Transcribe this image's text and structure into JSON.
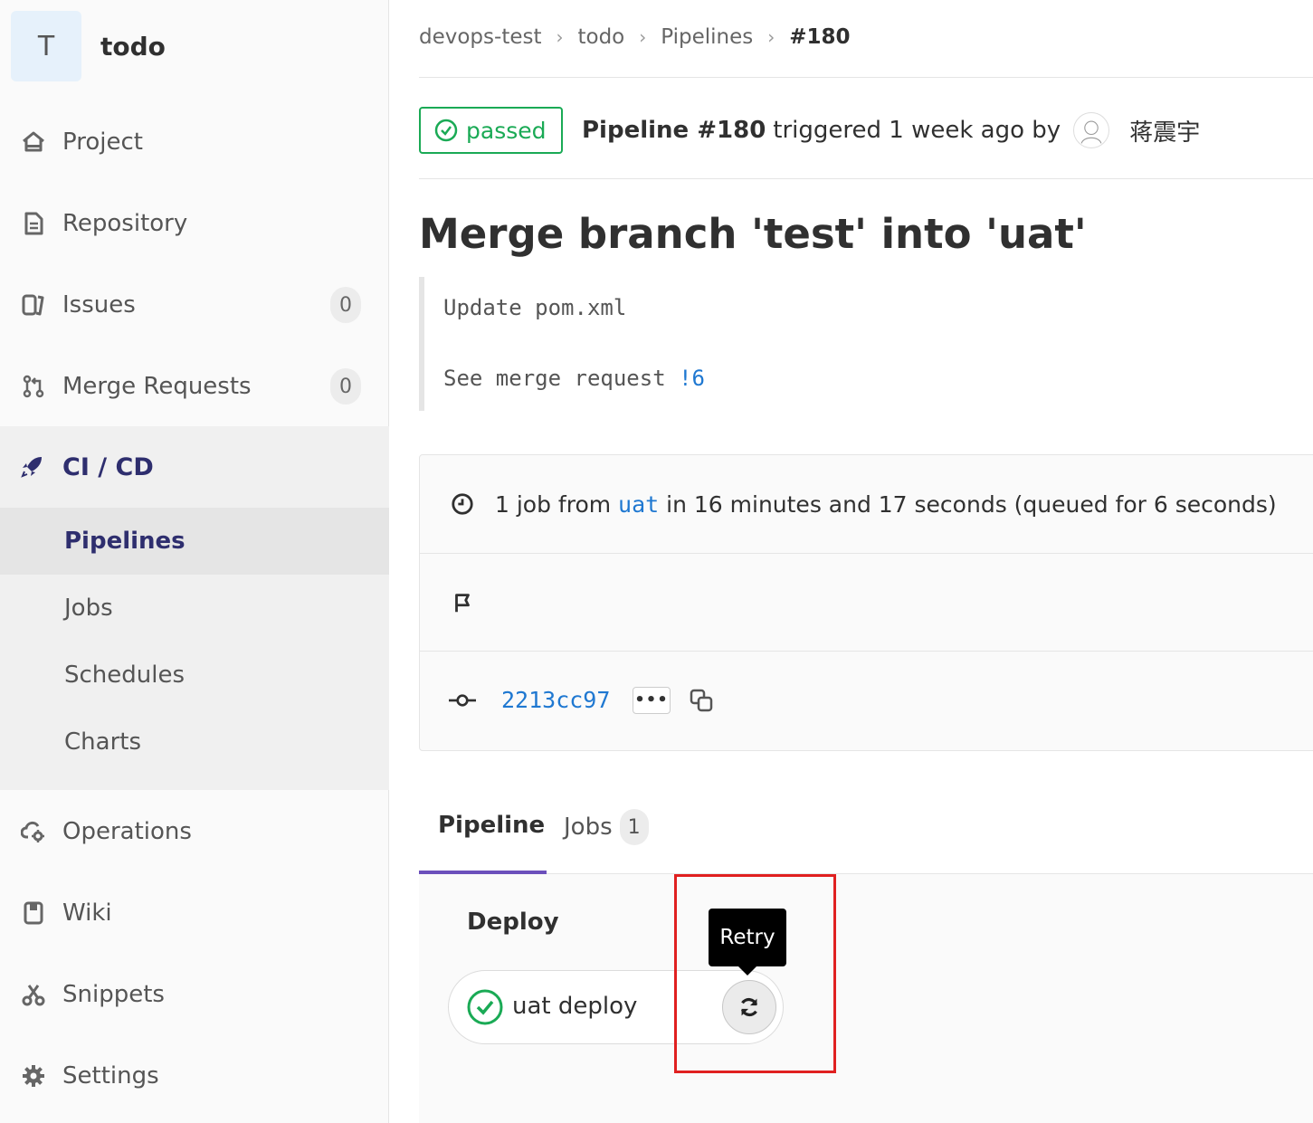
{
  "project": {
    "avatar_letter": "T",
    "name": "todo"
  },
  "sidebar": {
    "items": [
      {
        "label": "Project",
        "icon": "home-icon"
      },
      {
        "label": "Repository",
        "icon": "document-icon"
      },
      {
        "label": "Issues",
        "icon": "issues-icon",
        "count": "0"
      },
      {
        "label": "Merge Requests",
        "icon": "merge-request-icon",
        "count": "0"
      }
    ],
    "cicd": {
      "label": "CI / CD",
      "icon": "rocket-icon",
      "sub_items": [
        "Pipelines",
        "Jobs",
        "Schedules",
        "Charts"
      ],
      "active": "Pipelines"
    },
    "bottom_items": [
      {
        "label": "Operations",
        "icon": "cloud-gear-icon"
      },
      {
        "label": "Wiki",
        "icon": "book-icon"
      },
      {
        "label": "Snippets",
        "icon": "scissors-icon"
      },
      {
        "label": "Settings",
        "icon": "gear-icon"
      }
    ]
  },
  "breadcrumb": [
    "devops-test",
    "todo",
    "Pipelines",
    "#180"
  ],
  "pipeline": {
    "status": "passed",
    "title": "Pipeline #180",
    "triggered_text": "triggered 1 week ago by",
    "author": "蒋震宇"
  },
  "commit": {
    "title": "Merge branch 'test' into 'uat'",
    "desc_line1": "Update pom.xml",
    "desc_line2_prefix": "See merge request ",
    "mr_link": "!6"
  },
  "info": {
    "jobs_prefix": "1 job from ",
    "branch": "uat",
    "jobs_suffix": " in 16 minutes and 17 seconds (queued for 6 seconds)",
    "sha": "2213cc97",
    "ellipsis": "•••"
  },
  "tabs": [
    {
      "label": "Pipeline"
    },
    {
      "label": "Jobs",
      "count": "1"
    }
  ],
  "graph": {
    "stage": "Deploy",
    "job_name": "uat deploy",
    "tooltip": "Retry"
  },
  "colors": {
    "success": "#1aaa55",
    "link": "#1f78d1",
    "highlight": "#e02020",
    "active_nav": "#2e2e6e"
  }
}
